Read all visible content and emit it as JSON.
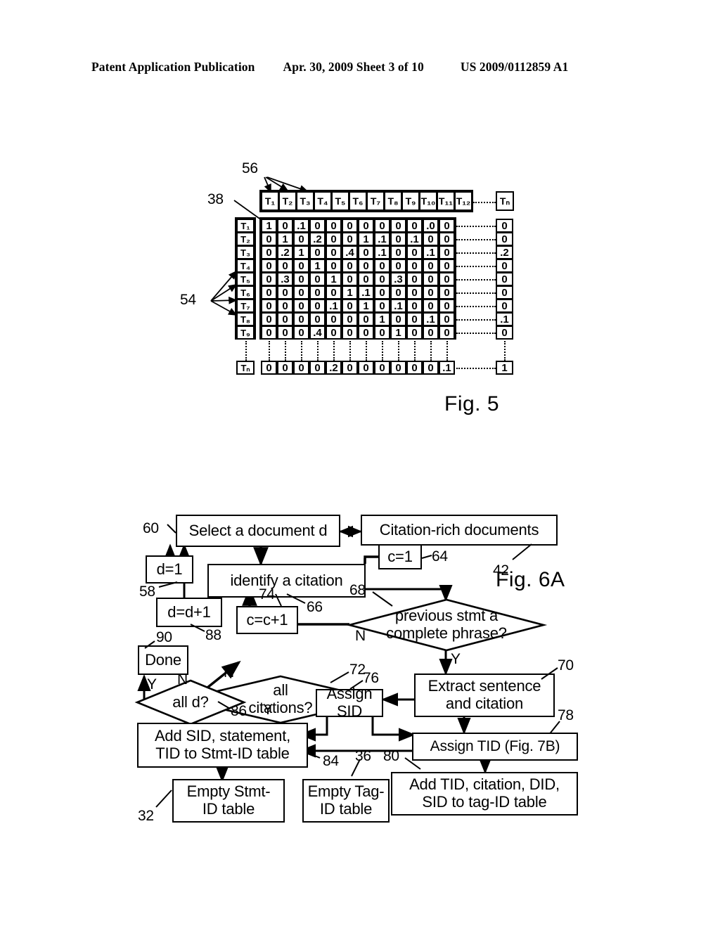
{
  "header": {
    "left": "Patent Application Publication",
    "middle": "Apr. 30, 2009  Sheet 3 of 10",
    "right": "US 2009/0112859 A1"
  },
  "fig5": {
    "label": "Fig. 5",
    "refs": {
      "r56": "56",
      "r38": "38",
      "r54": "54"
    },
    "column_headers": [
      "T₁",
      "T₂",
      "T₃",
      "T₄",
      "T₅",
      "T₆",
      "T₇",
      "T₈",
      "T₉",
      "T₁₀",
      "T₁₁",
      "T₁₂"
    ],
    "column_header_last": "Tₙ",
    "row_labels": [
      "T₁",
      "T₂",
      "T₃",
      "T₄",
      "T₅",
      "T₆",
      "T₇",
      "T₈",
      "T₉"
    ],
    "row_label_last": "Tₙ",
    "matrix": [
      [
        "1",
        "0",
        ".1",
        "0",
        "0",
        "0",
        "0",
        "0",
        "0",
        "0",
        ".0",
        "0"
      ],
      [
        "0",
        "1",
        "0",
        ".2",
        "0",
        "0",
        "1",
        ".1",
        "0",
        ".1",
        "0",
        "0"
      ],
      [
        "0",
        ".2",
        "1",
        "0",
        "0",
        ".4",
        "0",
        ".1",
        "0",
        "0",
        ".1",
        "0"
      ],
      [
        "0",
        "0",
        "0",
        "1",
        "0",
        "0",
        "0",
        "0",
        "0",
        "0",
        "0",
        "0"
      ],
      [
        "0",
        ".3",
        "0",
        "0",
        "1",
        "0",
        "0",
        "0",
        ".3",
        "0",
        "0",
        "0"
      ],
      [
        "0",
        "0",
        "0",
        "0",
        "0",
        "1",
        ".1",
        "0",
        "0",
        "0",
        "0",
        "0"
      ],
      [
        "0",
        "0",
        "0",
        "0",
        ".1",
        "0",
        "1",
        "0",
        ".1",
        "0",
        "0",
        "0"
      ],
      [
        "0",
        "0",
        "0",
        "0",
        "0",
        "0",
        "0",
        "1",
        "0",
        "0",
        ".1",
        "0"
      ],
      [
        "0",
        "0",
        "0",
        ".4",
        "0",
        "0",
        "0",
        "0",
        "1",
        "0",
        "0",
        "0"
      ]
    ],
    "matrix_last_row": [
      "0",
      "0",
      "0",
      "0",
      ".2",
      "0",
      "0",
      "0",
      "0",
      "0",
      "0",
      ".1"
    ],
    "last_column": [
      "0",
      "0",
      ".2",
      "0",
      "0",
      "0",
      "0",
      ".1",
      "0"
    ],
    "last_column_last_row": "1"
  },
  "fig6a": {
    "label": "Fig. 6A",
    "nodes": {
      "select_document": "Select a document d",
      "citation_rich": "Citation-rich documents",
      "d_init": "d=1",
      "identify_citation": "identify a citation",
      "c_init": "c=1",
      "d_increment": "d=d+1",
      "c_increment": "c=c+1",
      "done": "Done",
      "previous_stmt": "previous stmt a\ncomplete phrase?",
      "previous_stmt_line1": "previous stmt a",
      "previous_stmt_line2": "complete phrase?",
      "all_citations_line1": "all",
      "all_citations_line2": "citations?",
      "all_d": "all d?",
      "extract_line1": "Extract sentence",
      "extract_line2": "and citation",
      "assign_sid": "Assign SID",
      "assign_tid": "Assign TID (Fig. 7B)",
      "add_sid_line1": "Add SID, statement,",
      "add_sid_line2": "TID to Stmt-ID table",
      "add_tid_line1": "Add TID, citation, DID,",
      "add_tid_line2": "SID to tag-ID table",
      "empty_stmt_line1": "Empty Stmt-",
      "empty_stmt_line2": "ID table",
      "empty_tag_line1": "Empty Tag-",
      "empty_tag_line2": "ID table"
    },
    "branch_labels": {
      "prev_stmt_no": "N",
      "prev_stmt_yes": "Y",
      "all_citations_no": "N",
      "all_citations_yes": "Y",
      "all_d_no": "N",
      "all_d_yes": "Y"
    },
    "refs": {
      "r60": "60",
      "r58": "58",
      "r64": "64",
      "r42": "42",
      "r66": "66",
      "r68": "68",
      "r70": "70",
      "r72": "72",
      "r74": "74",
      "r76": "76",
      "r78": "78",
      "r80": "80",
      "r84": "84",
      "r86": "86",
      "r88": "88",
      "r90": "90",
      "r32": "32",
      "r36": "36"
    }
  }
}
